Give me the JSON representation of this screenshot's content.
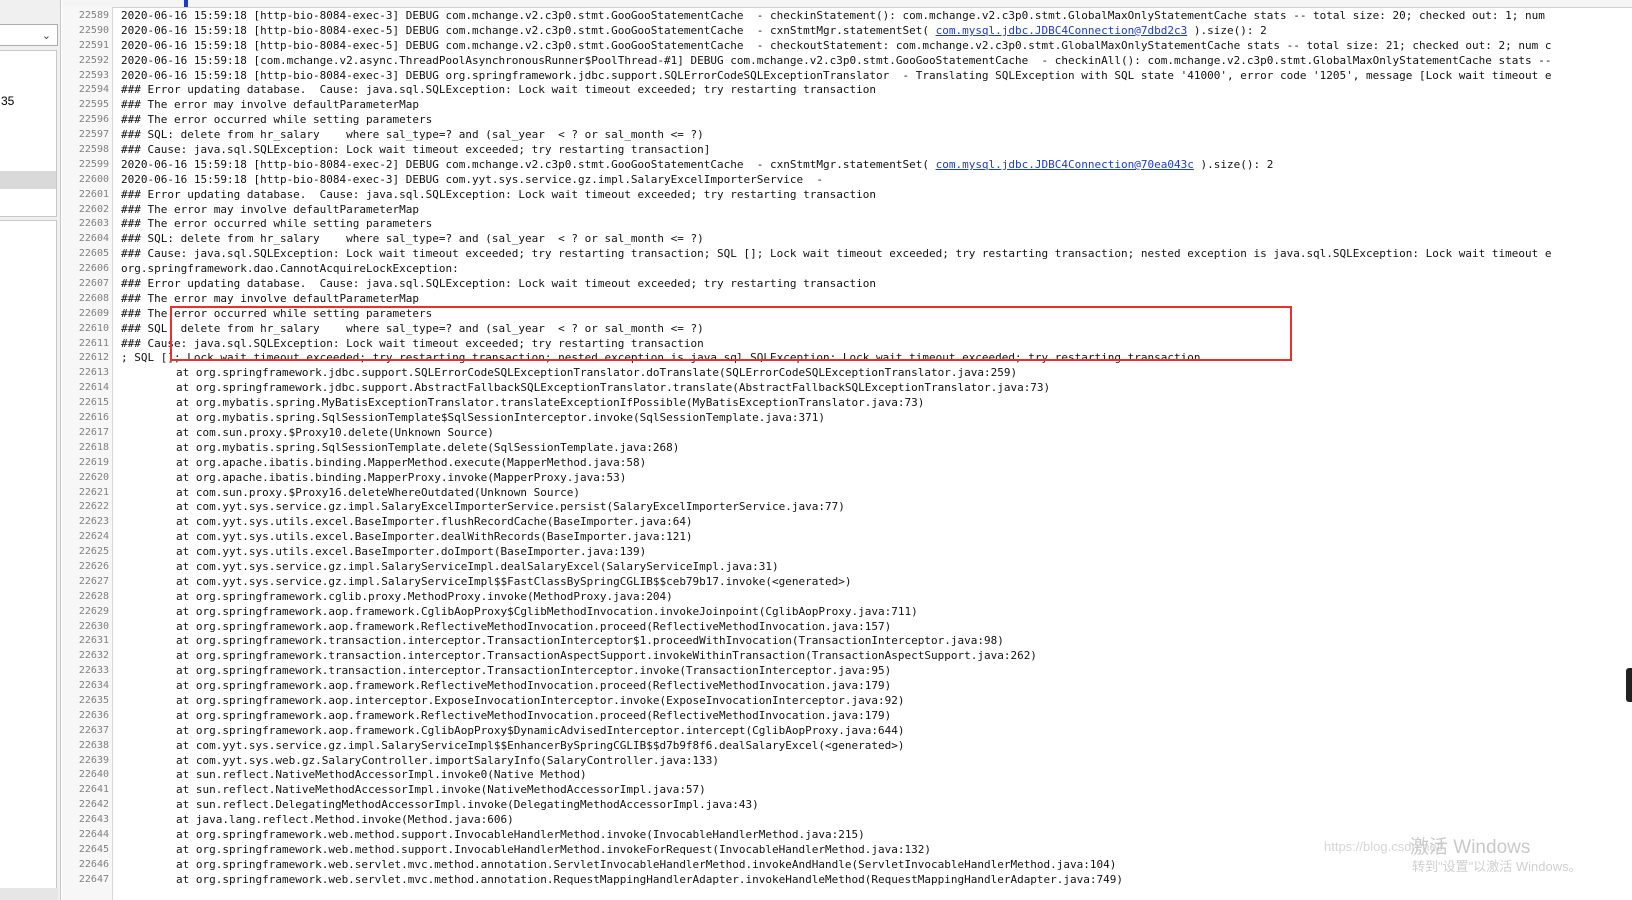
{
  "left_panel": {
    "dropdown_value": "",
    "list_number": "35"
  },
  "editor": {
    "lines": [
      {
        "n": "22589",
        "segments": [
          {
            "t": "2020-06-16 15:59:18 [http-bio-8084-exec-3] DEBUG com.mchange.v2.c3p0.stmt.GooGooStatementCache  - checkinStatement(): com.mchange.v2.c3p0.stmt.GlobalMaxOnlyStatementCache stats -- total size: 20; checked out: 1; num"
          }
        ]
      },
      {
        "n": "22590",
        "segments": [
          {
            "t": "2020-06-16 15:59:18 [http-bio-8084-exec-5] DEBUG com.mchange.v2.c3p0.stmt.GooGooStatementCache  - cxnStmtMgr.statementSet( "
          },
          {
            "t": "com.mysql.jdbc.JDBC4Connection@7dbd2c3",
            "link": true
          },
          {
            "t": " ).size(): 2"
          }
        ]
      },
      {
        "n": "22591",
        "segments": [
          {
            "t": "2020-06-16 15:59:18 [http-bio-8084-exec-5] DEBUG com.mchange.v2.c3p0.stmt.GooGooStatementCache  - checkoutStatement: com.mchange.v2.c3p0.stmt.GlobalMaxOnlyStatementCache stats -- total size: 21; checked out: 2; num c"
          }
        ]
      },
      {
        "n": "22592",
        "segments": [
          {
            "t": "2020-06-16 15:59:18 [com.mchange.v2.async.ThreadPoolAsynchronousRunner$PoolThread-#1] DEBUG com.mchange.v2.c3p0.stmt.GooGooStatementCache  - checkinAll(): com.mchange.v2.c3p0.stmt.GlobalMaxOnlyStatementCache stats --"
          }
        ]
      },
      {
        "n": "22593",
        "segments": [
          {
            "t": "2020-06-16 15:59:18 [http-bio-8084-exec-3] DEBUG org.springframework.jdbc.support.SQLErrorCodeSQLExceptionTranslator  - Translating SQLException with SQL state '41000', error code '1205', message [Lock wait timeout e"
          }
        ]
      },
      {
        "n": "22594",
        "segments": [
          {
            "t": "### Error updating database.  Cause: java.sql.SQLException: Lock wait timeout exceeded; try restarting transaction"
          }
        ]
      },
      {
        "n": "22595",
        "segments": [
          {
            "t": "### The error may involve defaultParameterMap"
          }
        ]
      },
      {
        "n": "22596",
        "segments": [
          {
            "t": "### The error occurred while setting parameters"
          }
        ]
      },
      {
        "n": "22597",
        "segments": [
          {
            "t": "### SQL: delete from hr_salary    where sal_type=? and (sal_year  < ? or sal_month <= ?)"
          }
        ]
      },
      {
        "n": "22598",
        "segments": [
          {
            "t": "### Cause: java.sql.SQLException: Lock wait timeout exceeded; try restarting transaction]"
          }
        ]
      },
      {
        "n": "22599",
        "segments": [
          {
            "t": "2020-06-16 15:59:18 [http-bio-8084-exec-2] DEBUG com.mchange.v2.c3p0.stmt.GooGooStatementCache  - cxnStmtMgr.statementSet( "
          },
          {
            "t": "com.mysql.jdbc.JDBC4Connection@70ea043c",
            "link": true
          },
          {
            "t": " ).size(): 2"
          }
        ]
      },
      {
        "n": "22600",
        "segments": [
          {
            "t": "2020-06-16 15:59:18 [http-bio-8084-exec-3] DEBUG com.yyt.sys.service.gz.impl.SalaryExcelImporterService  -"
          }
        ]
      },
      {
        "n": "22601",
        "segments": [
          {
            "t": "### Error updating database.  Cause: java.sql.SQLException: Lock wait timeout exceeded; try restarting transaction"
          }
        ]
      },
      {
        "n": "22602",
        "segments": [
          {
            "t": "### The error may involve defaultParameterMap"
          }
        ]
      },
      {
        "n": "22603",
        "segments": [
          {
            "t": "### The error occurred while setting parameters"
          }
        ]
      },
      {
        "n": "22604",
        "segments": [
          {
            "t": "### SQL: delete from hr_salary    where sal_type=? and (sal_year  < ? or sal_month <= ?)"
          }
        ]
      },
      {
        "n": "22605",
        "segments": [
          {
            "t": "### Cause: java.sql.SQLException: Lock wait timeout exceeded; try restarting transaction; SQL []; Lock wait timeout exceeded; try restarting transaction; nested exception is java.sql.SQLException: Lock wait timeout e"
          }
        ]
      },
      {
        "n": "22606",
        "segments": [
          {
            "t": "org.springframework.dao.CannotAcquireLockException:"
          }
        ]
      },
      {
        "n": "22607",
        "segments": [
          {
            "t": "### Error updating database.  Cause: java.sql.SQLException: Lock wait timeout exceeded; try restarting transaction"
          }
        ]
      },
      {
        "n": "22608",
        "segments": [
          {
            "t": "### The error may involve defaultParameterMap"
          }
        ]
      },
      {
        "n": "22609",
        "segments": [
          {
            "t": "### The error occurred while setting parameters"
          }
        ]
      },
      {
        "n": "22610",
        "segments": [
          {
            "t": "### SQL: delete from hr_salary    where sal_type=? and (sal_year  < ? or sal_month <= ?)"
          }
        ]
      },
      {
        "n": "22611",
        "segments": [
          {
            "t": "### Cause: java.sql.SQLException: Lock wait timeout exceeded; try restarting transaction"
          }
        ]
      },
      {
        "n": "22612",
        "segments": [
          {
            "t": "; SQL []; Lock wait timeout exceeded; try restarting transaction; nested exception is java.sql.SQLException: Lock wait timeout exceeded; try restarting transaction"
          }
        ]
      },
      {
        "n": "22613",
        "indent": true,
        "segments": [
          {
            "t": "at org.springframework.jdbc.support.SQLErrorCodeSQLExceptionTranslator.doTranslate(SQLErrorCodeSQLExceptionTranslator.java:259)"
          }
        ]
      },
      {
        "n": "22614",
        "indent": true,
        "segments": [
          {
            "t": "at org.springframework.jdbc.support.AbstractFallbackSQLExceptionTranslator.translate(AbstractFallbackSQLExceptionTranslator.java:73)"
          }
        ]
      },
      {
        "n": "22615",
        "indent": true,
        "segments": [
          {
            "t": "at org.mybatis.spring.MyBatisExceptionTranslator.translateExceptionIfPossible(MyBatisExceptionTranslator.java:73)"
          }
        ]
      },
      {
        "n": "22616",
        "indent": true,
        "segments": [
          {
            "t": "at org.mybatis.spring.SqlSessionTemplate$SqlSessionInterceptor.invoke(SqlSessionTemplate.java:371)"
          }
        ]
      },
      {
        "n": "22617",
        "indent": true,
        "segments": [
          {
            "t": "at com.sun.proxy.$Proxy10.delete(Unknown Source)"
          }
        ]
      },
      {
        "n": "22618",
        "indent": true,
        "segments": [
          {
            "t": "at org.mybatis.spring.SqlSessionTemplate.delete(SqlSessionTemplate.java:268)"
          }
        ]
      },
      {
        "n": "22619",
        "indent": true,
        "segments": [
          {
            "t": "at org.apache.ibatis.binding.MapperMethod.execute(MapperMethod.java:58)"
          }
        ]
      },
      {
        "n": "22620",
        "indent": true,
        "segments": [
          {
            "t": "at org.apache.ibatis.binding.MapperProxy.invoke(MapperProxy.java:53)"
          }
        ]
      },
      {
        "n": "22621",
        "indent": true,
        "segments": [
          {
            "t": "at com.sun.proxy.$Proxy16.deleteWhereOutdated(Unknown Source)"
          }
        ]
      },
      {
        "n": "22622",
        "indent": true,
        "segments": [
          {
            "t": "at com.yyt.sys.service.gz.impl.SalaryExcelImporterService.persist(SalaryExcelImporterService.java:77)"
          }
        ]
      },
      {
        "n": "22623",
        "indent": true,
        "segments": [
          {
            "t": "at com.yyt.sys.utils.excel.BaseImporter.flushRecordCache(BaseImporter.java:64)"
          }
        ]
      },
      {
        "n": "22624",
        "indent": true,
        "segments": [
          {
            "t": "at com.yyt.sys.utils.excel.BaseImporter.dealWithRecords(BaseImporter.java:121)"
          }
        ]
      },
      {
        "n": "22625",
        "indent": true,
        "segments": [
          {
            "t": "at com.yyt.sys.utils.excel.BaseImporter.doImport(BaseImporter.java:139)"
          }
        ]
      },
      {
        "n": "22626",
        "indent": true,
        "segments": [
          {
            "t": "at com.yyt.sys.service.gz.impl.SalaryServiceImpl.dealSalaryExcel(SalaryServiceImpl.java:31)"
          }
        ]
      },
      {
        "n": "22627",
        "indent": true,
        "segments": [
          {
            "t": "at com.yyt.sys.service.gz.impl.SalaryServiceImpl$$FastClassBySpringCGLIB$$ceb79b17.invoke(<generated>)"
          }
        ]
      },
      {
        "n": "22628",
        "indent": true,
        "segments": [
          {
            "t": "at org.springframework.cglib.proxy.MethodProxy.invoke(MethodProxy.java:204)"
          }
        ]
      },
      {
        "n": "22629",
        "indent": true,
        "segments": [
          {
            "t": "at org.springframework.aop.framework.CglibAopProxy$CglibMethodInvocation.invokeJoinpoint(CglibAopProxy.java:711)"
          }
        ]
      },
      {
        "n": "22630",
        "indent": true,
        "segments": [
          {
            "t": "at org.springframework.aop.framework.ReflectiveMethodInvocation.proceed(ReflectiveMethodInvocation.java:157)"
          }
        ]
      },
      {
        "n": "22631",
        "indent": true,
        "segments": [
          {
            "t": "at org.springframework.transaction.interceptor.TransactionInterceptor$1.proceedWithInvocation(TransactionInterceptor.java:98)"
          }
        ]
      },
      {
        "n": "22632",
        "indent": true,
        "segments": [
          {
            "t": "at org.springframework.transaction.interceptor.TransactionAspectSupport.invokeWithinTransaction(TransactionAspectSupport.java:262)"
          }
        ]
      },
      {
        "n": "22633",
        "indent": true,
        "segments": [
          {
            "t": "at org.springframework.transaction.interceptor.TransactionInterceptor.invoke(TransactionInterceptor.java:95)"
          }
        ]
      },
      {
        "n": "22634",
        "indent": true,
        "segments": [
          {
            "t": "at org.springframework.aop.framework.ReflectiveMethodInvocation.proceed(ReflectiveMethodInvocation.java:179)"
          }
        ]
      },
      {
        "n": "22635",
        "indent": true,
        "segments": [
          {
            "t": "at org.springframework.aop.interceptor.ExposeInvocationInterceptor.invoke(ExposeInvocationInterceptor.java:92)"
          }
        ]
      },
      {
        "n": "22636",
        "indent": true,
        "segments": [
          {
            "t": "at org.springframework.aop.framework.ReflectiveMethodInvocation.proceed(ReflectiveMethodInvocation.java:179)"
          }
        ]
      },
      {
        "n": "22637",
        "indent": true,
        "segments": [
          {
            "t": "at org.springframework.aop.framework.CglibAopProxy$DynamicAdvisedInterceptor.intercept(CglibAopProxy.java:644)"
          }
        ]
      },
      {
        "n": "22638",
        "indent": true,
        "segments": [
          {
            "t": "at com.yyt.sys.service.gz.impl.SalaryServiceImpl$$EnhancerBySpringCGLIB$$d7b9f8f6.dealSalaryExcel(<generated>)"
          }
        ]
      },
      {
        "n": "22639",
        "indent": true,
        "segments": [
          {
            "t": "at com.yyt.sys.web.gz.SalaryController.importSalaryInfo(SalaryController.java:133)"
          }
        ]
      },
      {
        "n": "22640",
        "indent": true,
        "segments": [
          {
            "t": "at sun.reflect.NativeMethodAccessorImpl.invoke0(Native Method)"
          }
        ]
      },
      {
        "n": "22641",
        "indent": true,
        "segments": [
          {
            "t": "at sun.reflect.NativeMethodAccessorImpl.invoke(NativeMethodAccessorImpl.java:57)"
          }
        ]
      },
      {
        "n": "22642",
        "indent": true,
        "segments": [
          {
            "t": "at sun.reflect.DelegatingMethodAccessorImpl.invoke(DelegatingMethodAccessorImpl.java:43)"
          }
        ]
      },
      {
        "n": "22643",
        "indent": true,
        "segments": [
          {
            "t": "at java.lang.reflect.Method.invoke(Method.java:606)"
          }
        ]
      },
      {
        "n": "22644",
        "indent": true,
        "segments": [
          {
            "t": "at org.springframework.web.method.support.InvocableHandlerMethod.invoke(InvocableHandlerMethod.java:215)"
          }
        ]
      },
      {
        "n": "22645",
        "indent": true,
        "segments": [
          {
            "t": "at org.springframework.web.method.support.InvocableHandlerMethod.invokeForRequest(InvocableHandlerMethod.java:132)"
          }
        ]
      },
      {
        "n": "22646",
        "indent": true,
        "segments": [
          {
            "t": "at org.springframework.web.servlet.mvc.method.annotation.ServletInvocableHandlerMethod.invokeAndHandle(ServletInvocableHandlerMethod.java:104)"
          }
        ]
      },
      {
        "n": "22647",
        "indent": true,
        "segments": [
          {
            "t": "at org.springframework.web.servlet.mvc.method.annotation.RequestMappingHandlerAdapter.invokeHandleMethod(RequestMappingHandlerAdapter.java:749)"
          }
        ]
      }
    ]
  },
  "overlay": {
    "windows_activation_title": "激活 Windows",
    "windows_activation_sub": "转到\"设置\"以激活 Windows。",
    "blog_watermark": "https://blog.csdn.net/"
  },
  "colors": {
    "highlight_box": "#e8302f",
    "link": "#1a3ccf",
    "line_number": "#808080",
    "ruler_marker": "#1a3cc8"
  }
}
